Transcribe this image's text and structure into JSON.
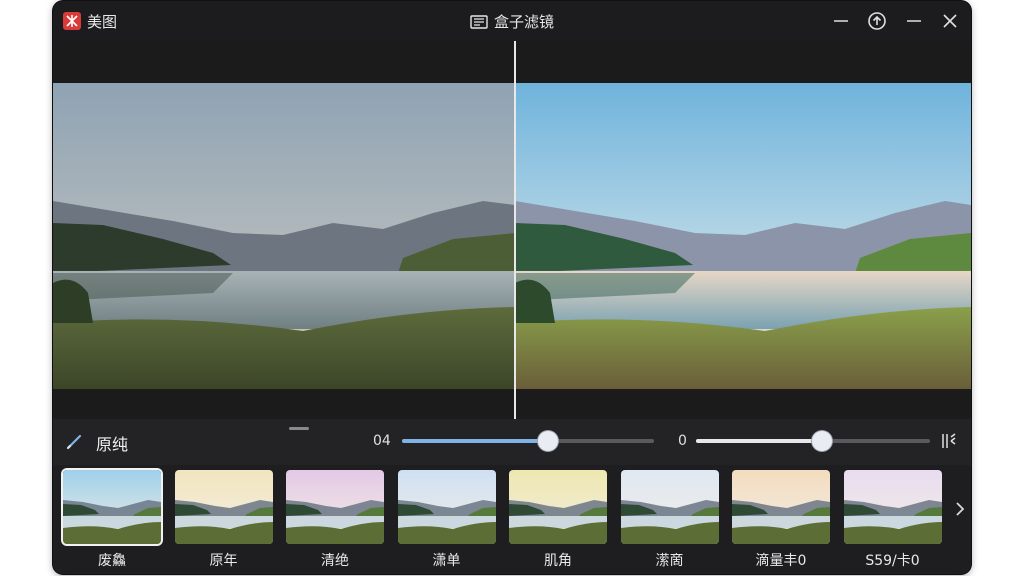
{
  "app": {
    "name": "美图"
  },
  "window": {
    "title": "盒子滤镜"
  },
  "controls": {
    "filter_name": "原纯",
    "slider1": {
      "value_label": "04",
      "level": 0.58
    },
    "slider2": {
      "value_label": "0",
      "level": 0.54
    }
  },
  "presets": [
    {
      "label": "废鱻",
      "selected": true,
      "tone": "#9fd0ea"
    },
    {
      "label": "原年",
      "selected": false,
      "tone": "#f1e6bf"
    },
    {
      "label": "清绝",
      "selected": false,
      "tone": "#e4c9e6"
    },
    {
      "label": "潇单",
      "selected": false,
      "tone": "#cfe0f4"
    },
    {
      "label": "肌角",
      "selected": false,
      "tone": "#eee7b0"
    },
    {
      "label": "潆啇",
      "selected": false,
      "tone": "#dfe8f3"
    },
    {
      "label": "滴量丰0",
      "selected": false,
      "tone": "#f3dcc0"
    },
    {
      "label": "S59/卡0",
      "selected": false,
      "tone": "#e8dcf0"
    }
  ],
  "colors": {
    "accent": "#7fb2e6",
    "brand": "#d93b3b",
    "window_bg": "#1f1f21"
  },
  "icons": [
    "app-logo-icon",
    "document-icon",
    "minimize-icon",
    "upload-icon",
    "maximize-icon",
    "close-icon",
    "brush-icon",
    "compare-icon",
    "chevron-right-icon"
  ]
}
